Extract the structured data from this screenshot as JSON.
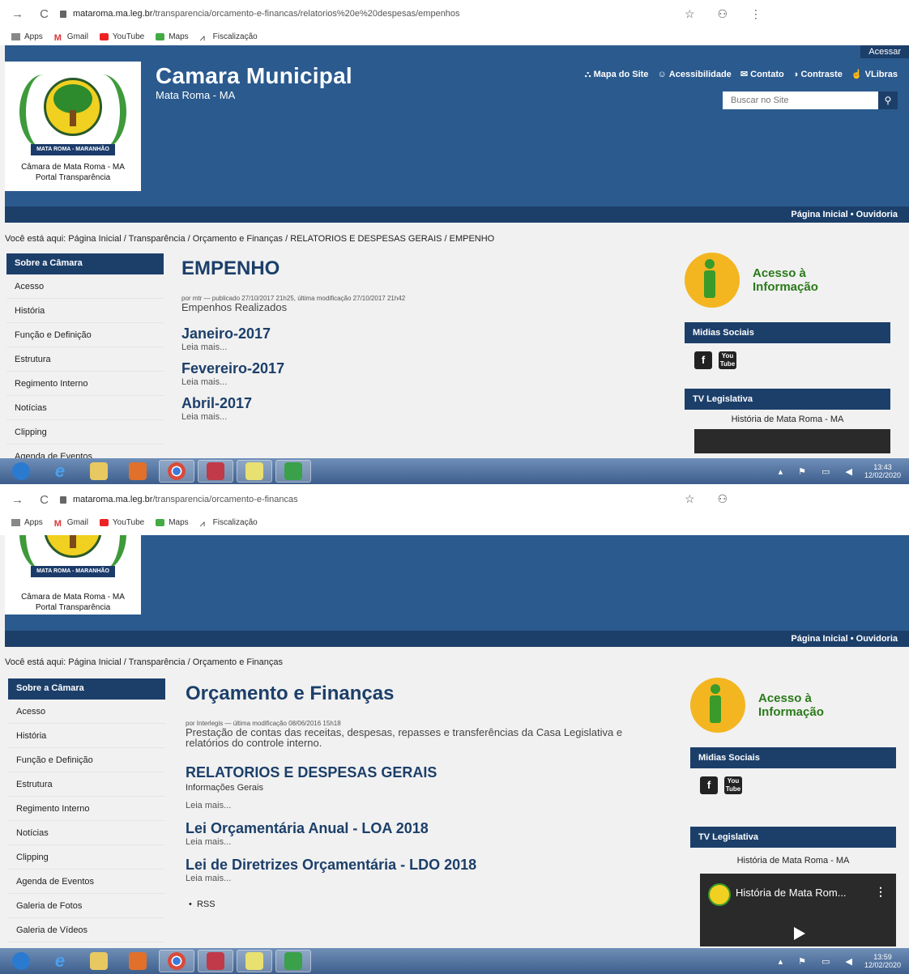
{
  "s1": {
    "url_domain": "mataroma.ma.leg.br",
    "url_path": "/transparencia/orcamento-e-financas/relatorios%20e%20despesas/empenhos",
    "bookmarks": [
      "Apps",
      "Gmail",
      "YouTube",
      "Maps",
      "Fiscalização"
    ],
    "acessar": "Acessar",
    "site_title": "Camara Municipal",
    "site_subtitle": "Mata Roma - MA",
    "emblem_text": "MATA ROMA - MARANHÃO",
    "logo_line1": "Câmara de Mata Roma - MA",
    "logo_line2": "Portal Transparência",
    "top_links": [
      "Mapa do Site",
      "Acessibilidade",
      "Contato",
      "Contraste",
      "VLibras"
    ],
    "search_placeholder": "Buscar no Site",
    "nav": "Página Inicial  •  Ouvidoria",
    "breadcrumb": "Você está aqui: Página Inicial / Transparência / Orçamento e Finanças / RELATORIOS E DESPESAS GERAIS / EMPENHO",
    "sidebar_head": "Sobre a Câmara",
    "sidebar_items": [
      "Acesso",
      "História",
      "Função e Definição",
      "Estrutura",
      "Regimento Interno",
      "Notícias",
      "Clipping",
      "Agenda de Eventos"
    ],
    "page_title": "EMPENHO",
    "byline": "por mtr — publicado 27/10/2017 21h25, última modificação 27/10/2017 21h42",
    "description": "Empenhos Realizados",
    "entries": [
      {
        "title": "Janeiro-2017",
        "more": "Leia mais..."
      },
      {
        "title": "Fevereiro-2017",
        "more": "Leia mais..."
      },
      {
        "title": "Abril-2017",
        "more": "Leia mais..."
      }
    ],
    "info_line1": "Acesso à",
    "info_line2": "Informação",
    "midias_head": "Midias Sociais",
    "tv_head": "TV Legislativa",
    "tv_caption": "História de Mata Roma - MA",
    "clock_time": "13:43",
    "clock_date": "12/02/2020"
  },
  "s2": {
    "url_domain": "mataroma.ma.leg.br",
    "url_path": "/transparencia/orcamento-e-financas",
    "bookmarks": [
      "Apps",
      "Gmail",
      "YouTube",
      "Maps",
      "Fiscalização"
    ],
    "emblem_text": "MATA ROMA - MARANHÃO",
    "logo_line1": "Câmara de Mata Roma - MA",
    "logo_line2": "Portal Transparência",
    "nav": "Página Inicial  •  Ouvidoria",
    "breadcrumb": "Você está aqui: Página Inicial / Transparência / Orçamento e Finanças",
    "sidebar_head": "Sobre a Câmara",
    "sidebar_items": [
      "Acesso",
      "História",
      "Função e Definição",
      "Estrutura",
      "Regimento Interno",
      "Notícias",
      "Clipping",
      "Agenda de Eventos",
      "Galeria de Fotos",
      "Galeria de Vídeos"
    ],
    "page_title": "Orçamento e Finanças",
    "byline": "por Interlegis — última modificação 08/06/2016 15h18",
    "description": "Prestação de contas das receitas, despesas, repasses e transferências da Casa Legislativa e relatórios do controle interno.",
    "entries": [
      {
        "title": "RELATORIOS E DESPESAS GERAIS",
        "sub": "Informações Gerais",
        "more": "Leia mais..."
      },
      {
        "title": "Lei Orçamentária Anual - LOA 2018",
        "more": "Leia mais..."
      },
      {
        "title": "Lei de Diretrizes Orçamentária - LDO 2018",
        "more": "Leia mais..."
      }
    ],
    "rss": "RSS",
    "info_line1": "Acesso à",
    "info_line2": "Informação",
    "midias_head": "Midias Sociais",
    "tv_head": "TV Legislativa",
    "tv_caption": "História de Mata Roma - MA",
    "video_title": "História de Mata Rom...",
    "clock_time": "13:59",
    "clock_date": "12/02/2020"
  }
}
